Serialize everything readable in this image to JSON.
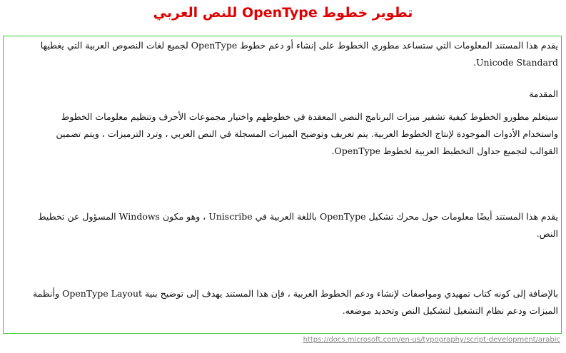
{
  "document": {
    "title": "تطوير خطوط OpenType للنص العربي",
    "intro": "يقدم هذا المستند المعلومات التي ستساعد مطوري الخطوط على إنشاء أو دعم خطوط OpenType لجميع لغات النصوص العربية التي يغطيها Unicode Standard.",
    "heading": "المقدمة",
    "body_1": "سيتعلم مطورو الخطوط كيفية تشفير ميزات البرنامج النصي المعقدة في خطوطهم واختيار مجموعات الأحرف وتنظيم معلومات الخطوط واستخدام الأدوات الموجودة لإنتاج الخطوط العربية. يتم تعريف وتوضيح الميزات المسجلة في النص العربي ، وترد الترميزات ، ويتم تضمين القوالب لتجميع جداول التخطيط العربية لخطوط OpenType.",
    "body_2": "يقدم هذا المستند أيضًا معلومات حول محرك تشكيل OpenType باللغة العربية في Uniscribe ، وهو مكون Windows المسؤول عن تخطيط النص.",
    "body_3": "بالإضافة إلى كونه كتاب تمهيدي ومواصفات لإنشاء ودعم الخطوط العربية ، فإن هذا المستند يهدف إلى توضيح بنية OpenType Layout وأنظمة الميزات ودعم نظام التشغيل لتشكيل النص وتحديد موضعه."
  },
  "footer": {
    "source_url": "https://docs.microsoft.com/en-us/typography/script-development/arabic"
  },
  "colors": {
    "title": "#e00000",
    "frame_border": "#33cc33",
    "text": "#111111",
    "footer_link": "#8a8a8a"
  }
}
